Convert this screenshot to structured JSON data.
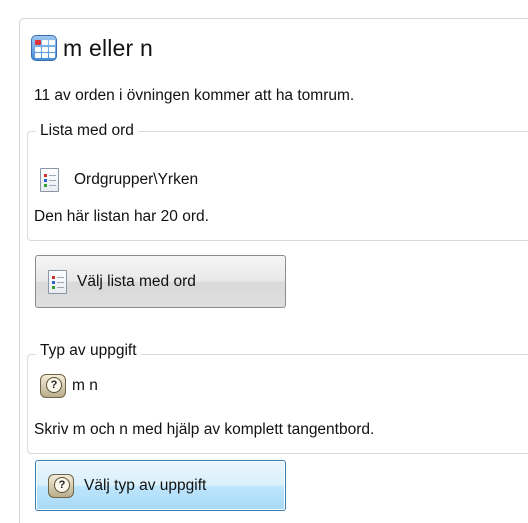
{
  "title": "m eller n",
  "intro": "11 av orden i övningen kommer att ha tomrum.",
  "word_list": {
    "legend": "Lista med ord",
    "name": "Ordgrupper\\Yrken",
    "info": "Den här listan har 20 ord.",
    "button_label": "Välj lista med ord"
  },
  "task_type": {
    "legend": "Typ av uppgift",
    "name": "m n",
    "info": "Skriv m och n med hjälp av komplett tangentbord.",
    "button_label": "Välj typ av uppgift"
  },
  "colors": {
    "border": "#cfd6de",
    "button_focus": "#3c7fb1"
  },
  "icons": {
    "app": "app-grid-icon",
    "list": "document-list-icon",
    "task": "keyboard-key-icon"
  }
}
